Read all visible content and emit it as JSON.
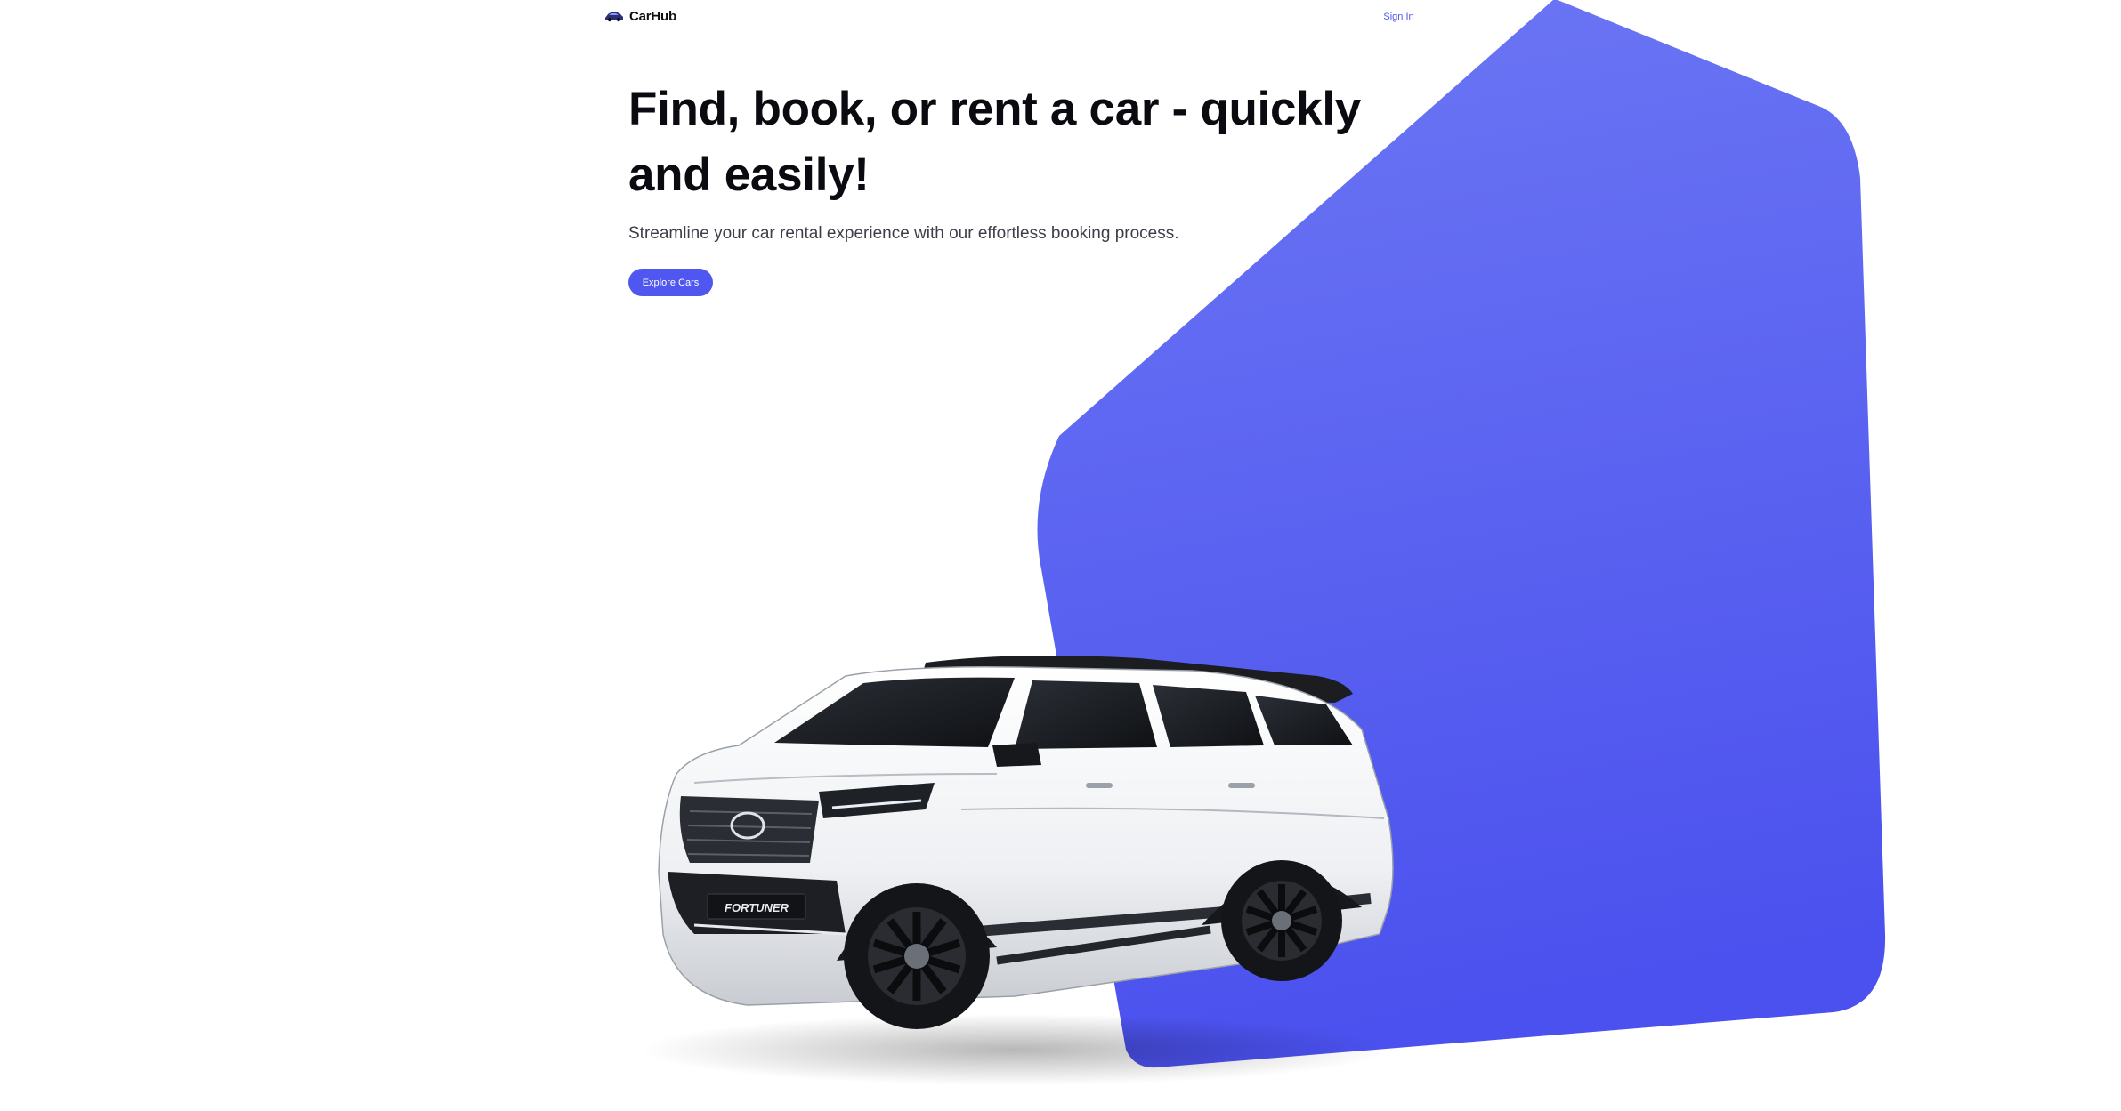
{
  "navbar": {
    "brand": "CarHub",
    "logo_icon": "car-logo-icon",
    "signin_label": "Sign In"
  },
  "hero": {
    "title": "Find, book, or rent a car - quickly and easily!",
    "subtitle": "Streamline your car rental experience with our effortless booking process.",
    "cta_label": "Explore Cars"
  },
  "car_image": {
    "icon": "suv-car-image",
    "plate_text": "FORTUNER"
  },
  "colors": {
    "accent": "#4f57f0",
    "shape_top": "#6b74f2",
    "shape_bottom": "#4d54ee",
    "text_dark": "#0a0a10",
    "text_muted": "#3e3e4a"
  }
}
